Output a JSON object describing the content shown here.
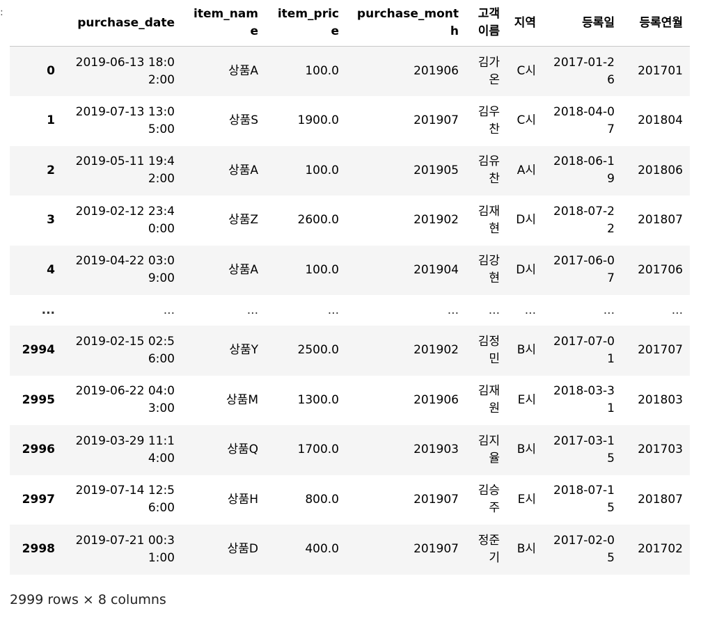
{
  "table": {
    "index_header": "",
    "columns": [
      "purchase_date",
      "item_name",
      "item_price",
      "purchase_month",
      "고객이름",
      "지역",
      "등록일",
      "등록연월"
    ],
    "rows": [
      {
        "index": "0",
        "cells": [
          "2019-06-13 18:02:00",
          "상품A",
          "100.0",
          "201906",
          "김가온",
          "C시",
          "2017-01-26",
          "201701"
        ]
      },
      {
        "index": "1",
        "cells": [
          "2019-07-13 13:05:00",
          "상품S",
          "1900.0",
          "201907",
          "김우찬",
          "C시",
          "2018-04-07",
          "201804"
        ]
      },
      {
        "index": "2",
        "cells": [
          "2019-05-11 19:42:00",
          "상품A",
          "100.0",
          "201905",
          "김유찬",
          "A시",
          "2018-06-19",
          "201806"
        ]
      },
      {
        "index": "3",
        "cells": [
          "2019-02-12 23:40:00",
          "상품Z",
          "2600.0",
          "201902",
          "김재현",
          "D시",
          "2018-07-22",
          "201807"
        ]
      },
      {
        "index": "4",
        "cells": [
          "2019-04-22 03:09:00",
          "상품A",
          "100.0",
          "201904",
          "김강현",
          "D시",
          "2017-06-07",
          "201706"
        ]
      },
      {
        "index": "...",
        "cells": [
          "...",
          "...",
          "...",
          "...",
          "...",
          "...",
          "...",
          "..."
        ]
      },
      {
        "index": "2994",
        "cells": [
          "2019-02-15 02:56:00",
          "상품Y",
          "2500.0",
          "201902",
          "김정민",
          "B시",
          "2017-07-01",
          "201707"
        ]
      },
      {
        "index": "2995",
        "cells": [
          "2019-06-22 04:03:00",
          "상품M",
          "1300.0",
          "201906",
          "김재원",
          "E시",
          "2018-03-31",
          "201803"
        ]
      },
      {
        "index": "2996",
        "cells": [
          "2019-03-29 11:14:00",
          "상품Q",
          "1700.0",
          "201903",
          "김지율",
          "B시",
          "2017-03-15",
          "201703"
        ]
      },
      {
        "index": "2997",
        "cells": [
          "2019-07-14 12:56:00",
          "상품H",
          "800.0",
          "201907",
          "김승주",
          "E시",
          "2018-07-15",
          "201807"
        ]
      },
      {
        "index": "2998",
        "cells": [
          "2019-07-21 00:31:00",
          "상품D",
          "400.0",
          "201907",
          "정준기",
          "B시",
          "2017-02-05",
          "201702"
        ]
      }
    ]
  },
  "footer": "2999 rows × 8 columns"
}
